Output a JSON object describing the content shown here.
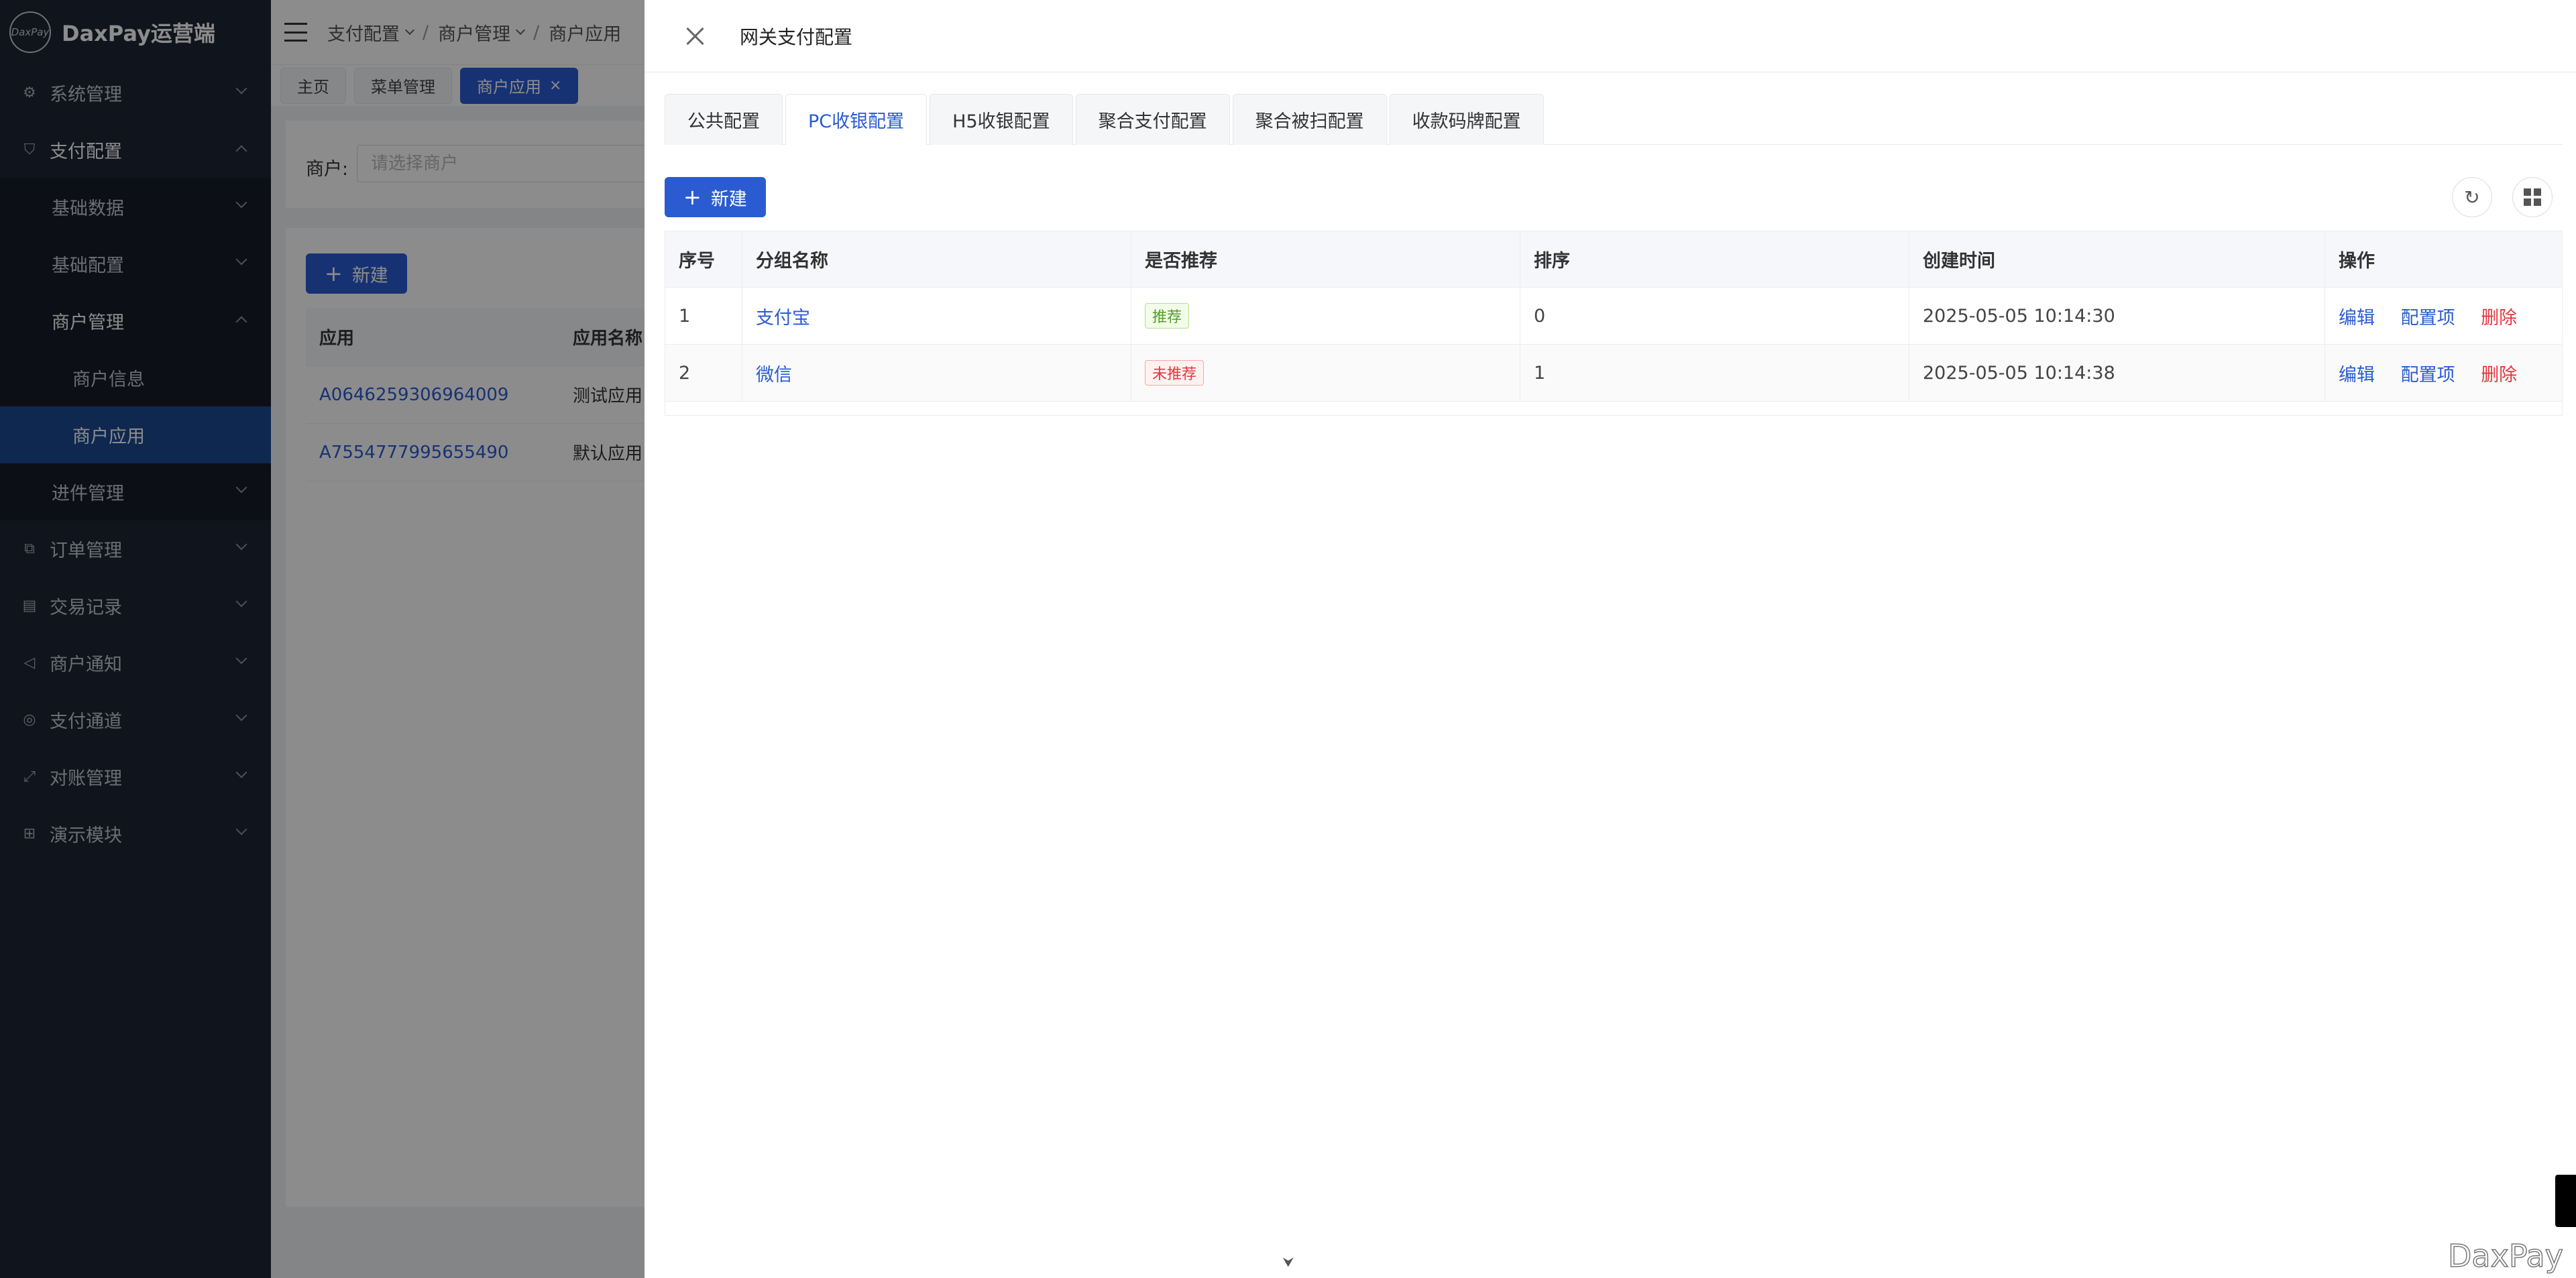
{
  "brand": {
    "logo_mark": "DaxPay",
    "title": "DaxPay运营端"
  },
  "sidebar": {
    "items": [
      {
        "label": "系统管理",
        "icon": "gear-icon"
      },
      {
        "label": "支付配置",
        "icon": "shield-icon"
      },
      {
        "label": "基础数据"
      },
      {
        "label": "基础配置"
      },
      {
        "label": "商户管理"
      },
      {
        "label": "商户信息"
      },
      {
        "label": "商户应用"
      },
      {
        "label": "进件管理"
      },
      {
        "label": "订单管理",
        "icon": "order-icon"
      },
      {
        "label": "交易记录",
        "icon": "record-icon"
      },
      {
        "label": "商户通知",
        "icon": "notify-icon"
      },
      {
        "label": "支付通道",
        "icon": "channel-icon"
      },
      {
        "label": "对账管理",
        "icon": "reconcile-icon"
      },
      {
        "label": "演示模块",
        "icon": "grid-icon"
      }
    ]
  },
  "breadcrumb": [
    "支付配置",
    "商户管理",
    "商户应用"
  ],
  "page_tabs": [
    {
      "label": "主页"
    },
    {
      "label": "菜单管理"
    },
    {
      "label": "商户应用",
      "close": "×"
    }
  ],
  "search": {
    "label": "商户:",
    "placeholder": "请选择商户"
  },
  "list": {
    "new_button": "新建",
    "columns": [
      "应用",
      "应用名称"
    ],
    "rows": [
      {
        "app": "A0646259306964009",
        "name": "测试应用"
      },
      {
        "app": "A7554777995655490",
        "name": "默认应用"
      }
    ]
  },
  "drawer": {
    "title": "网关支付配置",
    "tabs": [
      "公共配置",
      "PC收银配置",
      "H5收银配置",
      "聚合支付配置",
      "聚合被扫配置",
      "收款码牌配置"
    ],
    "active_tab": 1,
    "new_button": "新建",
    "table": {
      "columns": [
        "序号",
        "分组名称",
        "是否推荐",
        "排序",
        "创建时间",
        "操作"
      ],
      "rows": [
        {
          "index": "1",
          "name": "支付宝",
          "recommend": "推荐",
          "sort": "0",
          "created": "2025-05-05 10:14:30"
        },
        {
          "index": "2",
          "name": "微信",
          "recommend": "未推荐",
          "sort": "1",
          "created": "2025-05-05 10:14:38"
        }
      ],
      "ops": {
        "edit": "编辑",
        "config": "配置项",
        "delete": "删除"
      }
    }
  },
  "watermark": "DaxPay",
  "colors": {
    "primary": "#2a5bd1",
    "sidebar_bg": "#1e2533",
    "active_menu": "#1d4a93",
    "danger": "#e0383e",
    "success": "#52a02a"
  }
}
